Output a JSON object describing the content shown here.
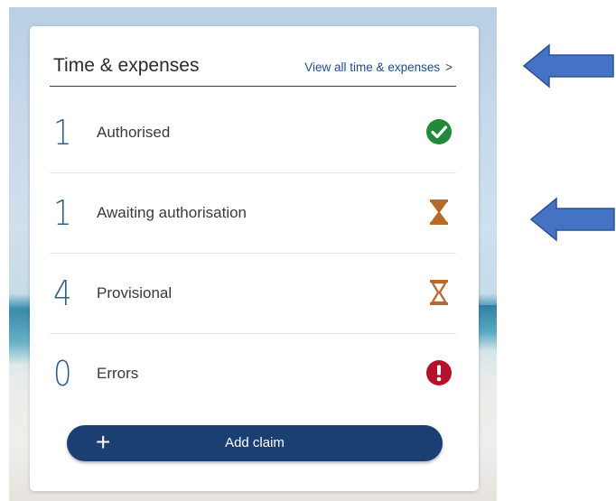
{
  "widget": {
    "title": "Time & expenses",
    "view_all_label": "View all time & expenses",
    "view_all_chevron": ">"
  },
  "rows": [
    {
      "count": "1",
      "label": "Authorised",
      "status_icon": "check-circle-icon",
      "status_color": "#1e8a3a"
    },
    {
      "count": "1",
      "label": "Awaiting authorisation",
      "status_icon": "hourglass-filled-icon",
      "status_color": "#b8692a"
    },
    {
      "count": "4",
      "label": "Provisional",
      "status_icon": "hourglass-outline-icon",
      "status_color": "#b8692a"
    },
    {
      "count": "0",
      "label": "Errors",
      "status_icon": "exclamation-circle-icon",
      "status_color": "#b3122a"
    }
  ],
  "add_button": {
    "label": "Add claim",
    "icon": "plus-icon"
  },
  "colors": {
    "accent": "#1b3f72",
    "link": "#1d4e86",
    "annotation_arrow": "#4472c4"
  }
}
